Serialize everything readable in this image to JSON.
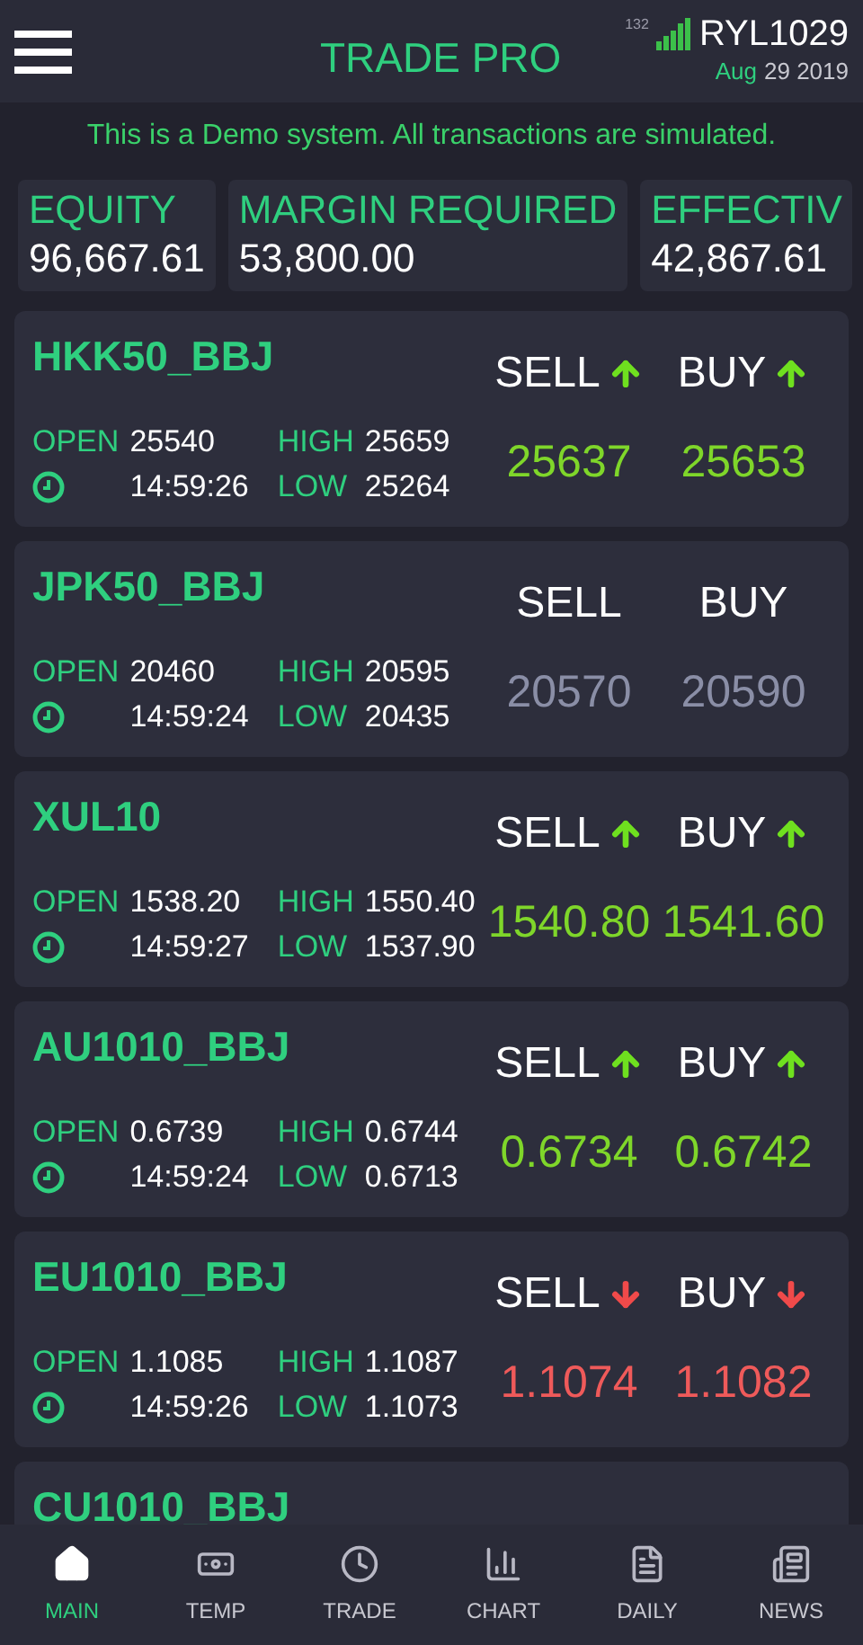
{
  "header": {
    "title": "TRADE PRO",
    "signal_label": "132",
    "account": "RYL1029",
    "date_month": "Aug",
    "date_rest": "29 2019"
  },
  "banner": "This is a Demo system. All transactions are simulated.",
  "stats": [
    {
      "label": "EQUITY",
      "value": "96,667.61"
    },
    {
      "label": "MARGIN REQUIRED",
      "value": "53,800.00"
    },
    {
      "label": "EFFECTIV",
      "value": "42,867.61"
    }
  ],
  "quotes": [
    {
      "symbol": "HKK50_BBJ",
      "open_label": "OPEN",
      "open": "25540",
      "high_label": "HIGH",
      "high": "25659",
      "time": "14:59:26",
      "low_label": "LOW",
      "low": "25264",
      "sell_label": "SELL",
      "buy_label": "BUY",
      "kind": "up",
      "sell": "25637",
      "buy": "25653"
    },
    {
      "symbol": "JPK50_BBJ",
      "open_label": "OPEN",
      "open": "20460",
      "high_label": "HIGH",
      "high": "20595",
      "time": "14:59:24",
      "low_label": "LOW",
      "low": "20435",
      "sell_label": "SELL",
      "buy_label": "BUY",
      "kind": "none",
      "sell": "20570",
      "buy": "20590"
    },
    {
      "symbol": "XUL10",
      "open_label": "OPEN",
      "open": "1538.20",
      "high_label": "HIGH",
      "high": "1550.40",
      "time": "14:59:27",
      "low_label": "LOW",
      "low": "1537.90",
      "sell_label": "SELL",
      "buy_label": "BUY",
      "kind": "up",
      "sell": "1540.80",
      "buy": "1541.60"
    },
    {
      "symbol": "AU1010_BBJ",
      "open_label": "OPEN",
      "open": "0.6739",
      "high_label": "HIGH",
      "high": "0.6744",
      "time": "14:59:24",
      "low_label": "LOW",
      "low": "0.6713",
      "sell_label": "SELL",
      "buy_label": "BUY",
      "kind": "up",
      "sell": "0.6734",
      "buy": "0.6742"
    },
    {
      "symbol": "EU1010_BBJ",
      "open_label": "OPEN",
      "open": "1.1085",
      "high_label": "HIGH",
      "high": "1.1087",
      "time": "14:59:26",
      "low_label": "LOW",
      "low": "1.1073",
      "sell_label": "SELL",
      "buy_label": "BUY",
      "kind": "down",
      "sell": "1.1074",
      "buy": "1.1082"
    }
  ],
  "partial_quote": {
    "symbol": "CU1010_BBJ"
  },
  "nav": [
    {
      "label": "MAIN",
      "kind": "home",
      "selected": true
    },
    {
      "label": "TEMP",
      "kind": "cash",
      "selected": false
    },
    {
      "label": "TRADE",
      "kind": "clock",
      "selected": false
    },
    {
      "label": "CHART",
      "kind": "chart",
      "selected": false
    },
    {
      "label": "DAILY",
      "kind": "report",
      "selected": false
    },
    {
      "label": "NEWS",
      "kind": "news",
      "selected": false
    }
  ]
}
